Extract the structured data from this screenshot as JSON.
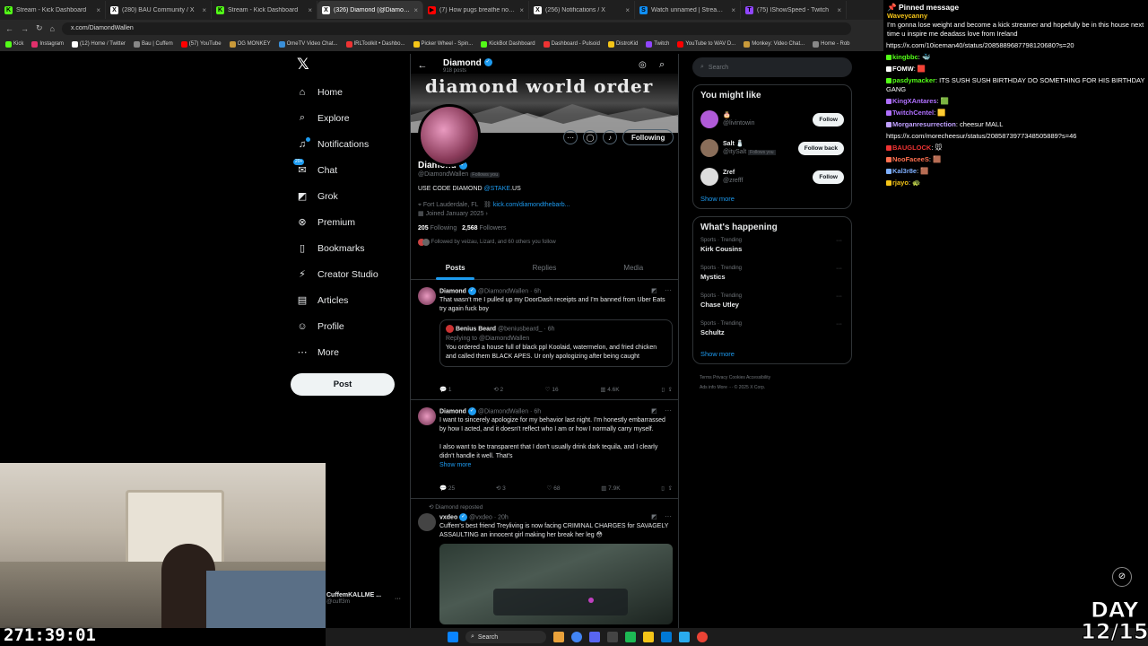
{
  "browser": {
    "tabs": [
      {
        "title": "Stream - Kick Dashboard",
        "color": "#53fc18",
        "glyph": "K"
      },
      {
        "title": "(280) BAU Community / X",
        "color": "#ffffff",
        "glyph": "X"
      },
      {
        "title": "Stream - Kick Dashboard",
        "color": "#53fc18",
        "glyph": "K"
      },
      {
        "title": "(326) Diamond (@DiamondWa",
        "color": "#ffffff",
        "glyph": "X",
        "active": true
      },
      {
        "title": "(7) How pugs breathe normally",
        "color": "#ff0000",
        "glyph": "▶"
      },
      {
        "title": "(256) Notifications / X",
        "color": "#ffffff",
        "glyph": "X"
      },
      {
        "title": "Watch unnamed | Streamable",
        "color": "#0f90fa",
        "glyph": "S"
      },
      {
        "title": "(75) IShowSpeed - Twitch",
        "color": "#9146ff",
        "glyph": "T"
      }
    ],
    "url": "x.com/DiamondWallen",
    "bookmarks": [
      {
        "label": "Kick",
        "color": "#53fc18"
      },
      {
        "label": "Instagram",
        "color": "#e1306c"
      },
      {
        "label": "(12) Home / Twitter",
        "color": "#fff"
      },
      {
        "label": "Bau | Cuffem",
        "color": "#888"
      },
      {
        "label": "(57) YouTube",
        "color": "#ff0000"
      },
      {
        "label": "OG MONKEY",
        "color": "#c99a3a"
      },
      {
        "label": "OmeTV Video Chat...",
        "color": "#3a8fd8"
      },
      {
        "label": "IRLToolkit • Dashbo...",
        "color": "#e33"
      },
      {
        "label": "Picker Wheel - Spin...",
        "color": "#f5c518"
      },
      {
        "label": "KickBot Dashboard",
        "color": "#53fc18"
      },
      {
        "label": "Dashboard - Pulsoid",
        "color": "#e33"
      },
      {
        "label": "DistroKid",
        "color": "#f5c518"
      },
      {
        "label": "Twitch",
        "color": "#9146ff"
      },
      {
        "label": "YouTube to WAV D...",
        "color": "#ff0000"
      },
      {
        "label": "Monkey: Video Chat...",
        "color": "#c99a3a"
      },
      {
        "label": "Home - Rob",
        "color": "#888"
      }
    ]
  },
  "nav": {
    "items": [
      {
        "label": "Home",
        "icon": "home-icon",
        "glyph": "⌂"
      },
      {
        "label": "Explore",
        "icon": "search-icon",
        "glyph": "⌕"
      },
      {
        "label": "Notifications",
        "icon": "bell-icon",
        "glyph": "♫"
      },
      {
        "label": "Chat",
        "icon": "chat-icon",
        "glyph": "✉",
        "badge": "20+"
      },
      {
        "label": "Grok",
        "icon": "grok-icon",
        "glyph": "◩"
      },
      {
        "label": "Premium",
        "icon": "premium-icon",
        "glyph": "⊗"
      },
      {
        "label": "Bookmarks",
        "icon": "bookmark-icon",
        "glyph": "▯"
      },
      {
        "label": "Creator Studio",
        "icon": "creator-studio-icon",
        "glyph": "⚡"
      },
      {
        "label": "Articles",
        "icon": "articles-icon",
        "glyph": "▤"
      },
      {
        "label": "Profile",
        "icon": "profile-icon",
        "glyph": "☺"
      },
      {
        "label": "More",
        "icon": "more-icon",
        "glyph": "⋯"
      }
    ],
    "post_label": "Post",
    "account_name": "CuffemKALLME ...",
    "account_handle": "@cuff3m"
  },
  "profile": {
    "header_name": "Diamond",
    "header_posts": "918 posts",
    "banner_text": "diamond world order",
    "name": "Diamond",
    "handle": "@DiamondWallen",
    "follows_you": "Follows you",
    "bio_pre": "USE CODE DIAMOND ",
    "bio_link": "@STAKE",
    "bio_post": ".US",
    "location": "Fort Lauderdale, FL",
    "website": "kick.com/diamondthebarb...",
    "joined": "Joined January 2025",
    "following_count": "205",
    "following_label": "Following",
    "followers_count": "2,568",
    "followers_label": "Followers",
    "followed_by": "Followed by veizau, Lizard, and 60 others you follow",
    "following_button": "Following",
    "tabs": [
      "Posts",
      "Replies",
      "Media"
    ]
  },
  "posts": [
    {
      "name": "Diamond",
      "handle": "@DiamondWallen · 6h",
      "text": "That wasn't me I pulled up my DoorDash receipts and I'm banned from Uber Eats try again fuck boy",
      "quote": {
        "name": "Benius Beard",
        "handle": "@beniusbeard_ · 6h",
        "replying": "Replying to @DiamondWallen",
        "text": "You ordered a house full of black ppl Koolaid, watermelon, and fried chicken and called them BLACK APES. Ur only apologizing after being caught"
      },
      "stats": {
        "replies": "1",
        "reposts": "2",
        "likes": "16",
        "views": "4.6K"
      }
    },
    {
      "name": "Diamond",
      "handle": "@DiamondWallen · 6h",
      "text": "I want to sincerely apologize for my behavior last night. I'm honestly embarrassed by how I acted, and it doesn't reflect who I am or how I normally carry myself.",
      "text2": "I also want to be transparent that I don't usually drink dark tequila, and I clearly didn't handle it well. That's",
      "show_more": "Show more",
      "stats": {
        "replies": "25",
        "reposts": "3",
        "likes": "68",
        "views": "7.9K"
      }
    },
    {
      "reposted": "Diamond reposted",
      "name": "vxdeo",
      "handle": "@vxdeo · 20h",
      "text": "Cuffem's best friend Treyliving is now facing CRIMINAL CHARGES for SAVAGELY ASSAULTING an innocent girl making her break her leg 😳"
    }
  ],
  "sidebar": {
    "search_placeholder": "Search",
    "wtf_title": "You might like",
    "suggestions": [
      {
        "name": "🎂",
        "handle": "@livintowin",
        "button": "Follow",
        "color": "#b05ad8"
      },
      {
        "name": "Salt 🧂",
        "handle": "@itySalt",
        "note": "Follows you",
        "button": "Follow back",
        "color": "#8a6e5a"
      },
      {
        "name": "Zref",
        "handle": "@zrefff",
        "button": "Follow",
        "color": "#ddd"
      }
    ],
    "show_more": "Show more",
    "happening_title": "What's happening",
    "trends": [
      {
        "cat": "Sports · Trending",
        "topic": "Kirk Cousins"
      },
      {
        "cat": "Sports · Trending",
        "topic": "Mystics"
      },
      {
        "cat": "Sports · Trending",
        "topic": "Chase Utley"
      },
      {
        "cat": "Sports · Trending",
        "topic": "Schultz"
      }
    ],
    "footer1": "Terms   Privacy   Cookies   Accessibility",
    "footer2": "Ads info   More ···   © 2025 X Corp."
  },
  "chat": {
    "pinned_label": "Pinned message",
    "pinned_user": "Waveycanny",
    "pinned_text": "I'm gonna lose weight and become a kick streamer and hopefully be in this house next time u inspire me deadass love from Ireland",
    "messages": [
      {
        "user": "",
        "text": "https://x.com/10iceman40/status/2085889687798120680?s=20",
        "color": "#fff"
      },
      {
        "user": "kingbbc",
        "text": "🐳",
        "color": "#53fc18"
      },
      {
        "user": "FOMW",
        "text": "🟥",
        "color": "#fff"
      },
      {
        "user": "pasdymacker",
        "text": "ITS SUSH SUSH BIRTHDAY DO SOMETHING FOR HIS BIRTHDAY GANG",
        "color": "#53fc18"
      },
      {
        "user": "KingXAntares",
        "text": "🟩",
        "color": "#b070ff"
      },
      {
        "user": "TwitchCentel",
        "text": "🟨",
        "color": "#b070ff"
      },
      {
        "user": "Morganresurrection",
        "text": "cheesur MALL",
        "color": "#c0a0ff"
      },
      {
        "user": "",
        "text": "https://x.com/morecheesur/status/2085873977348505889?s=46",
        "color": "#fff"
      },
      {
        "user": "BAUGLOCK",
        "text": "🐭",
        "color": "#e33"
      },
      {
        "user": "NooFaceeS",
        "text": "🟫",
        "color": "#ff7050"
      },
      {
        "user": "Kal3r8e",
        "text": "🟫",
        "color": "#7fb0ff"
      },
      {
        "user": "rjayo",
        "text": "🐢",
        "color": "#f5c518"
      }
    ]
  },
  "stream": {
    "timer": "271:39:01",
    "day": "DAY",
    "day_count": "12/15"
  },
  "taskbar": {
    "search": "Search"
  }
}
